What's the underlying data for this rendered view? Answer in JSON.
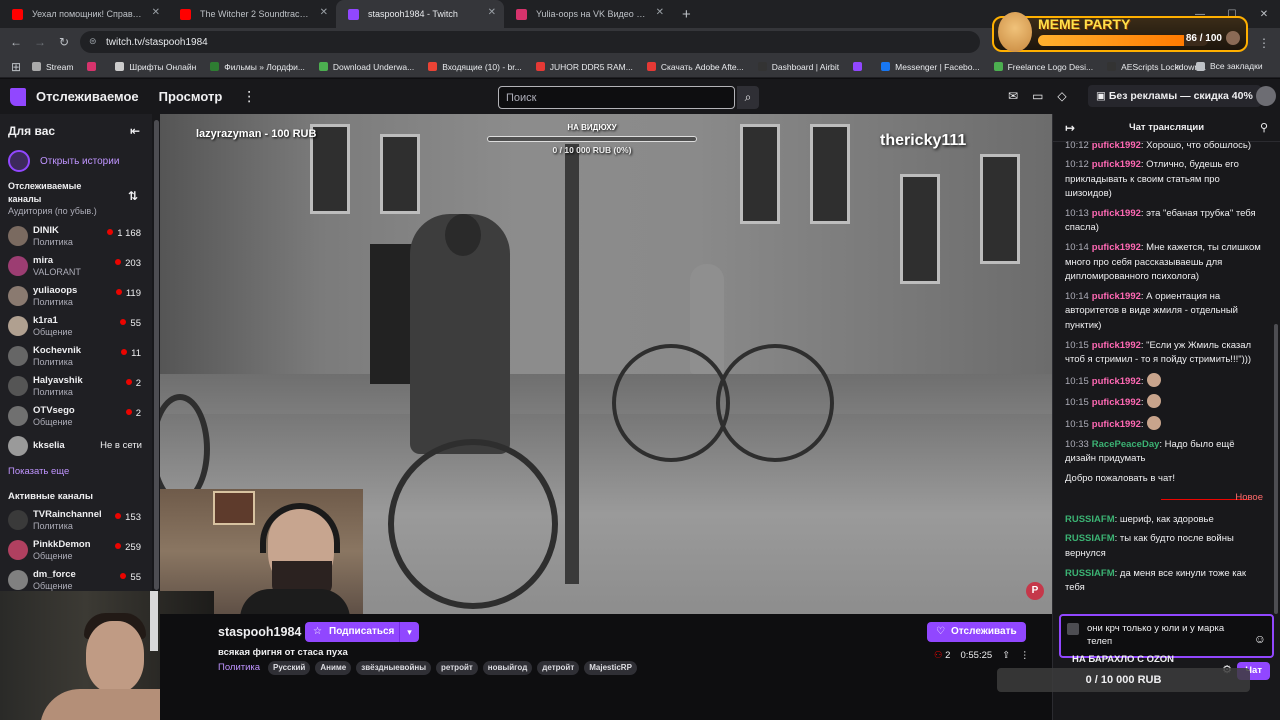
{
  "browser": {
    "tabs": [
      {
        "title": "Уехал помощник! Справляемся",
        "color": "#ff0000",
        "active": false
      },
      {
        "title": "The Witcher 2 Soundtrack - Sor",
        "color": "#ff0000",
        "active": false
      },
      {
        "title": "staspooh1984 - Twitch",
        "color": "#9147ff",
        "active": true
      },
      {
        "title": "Yulia-oops на VK Видео Live -",
        "color": "#d6336c",
        "active": false
      }
    ],
    "new_tab": "+",
    "url": "twitch.tv/staspooh1984",
    "bookmarks": [
      {
        "label": "Stream",
        "color": "#aaaaaa"
      },
      {
        "label": "",
        "color": "#d6336c"
      },
      {
        "label": "Шрифты Онлайн",
        "color": "#cccccc"
      },
      {
        "label": "Фильмы » Лордфи...",
        "color": "#2e7d32"
      },
      {
        "label": "Download Underwa...",
        "color": "#4caf50"
      },
      {
        "label": "Входящие (10) - br...",
        "color": "#ea4335"
      },
      {
        "label": "JUHOR DDR5 RAM...",
        "color": "#e53935"
      },
      {
        "label": "Скачать Adobe Afte...",
        "color": "#e53935"
      },
      {
        "label": "Dashboard | Airbit",
        "color": "#333333"
      },
      {
        "label": "",
        "color": "#9147ff"
      },
      {
        "label": "Messenger | Facebo...",
        "color": "#1877f2"
      },
      {
        "label": "Freelance Logo Desi...",
        "color": "#4caf50"
      },
      {
        "label": "AEScripts Lockdown...",
        "color": "#333333"
      }
    ],
    "bookmarks_more": "»",
    "all_bookmarks": "Все закладки"
  },
  "meme_party": {
    "title": "MEME PARTY",
    "count": "86 / 100",
    "progress": 0.86
  },
  "topnav": {
    "following": "Отслеживаемое",
    "browse": "Просмотр",
    "search_placeholder": "Поиск",
    "promo": "Без рекламы — скидка 40%"
  },
  "sidebar": {
    "title": "Для вас",
    "stories": "Открыть истории",
    "followed_title": "Отслеживаемые каналы",
    "followed_sub": "Аудитория (по убыв.)",
    "channels": [
      {
        "name": "DINIK",
        "game": "Политика",
        "viewers": "1 168",
        "color": "#7a6a60"
      },
      {
        "name": "mira",
        "game": "VALORANT",
        "viewers": "203",
        "color": "#9c3d72"
      },
      {
        "name": "yuliaoops",
        "game": "Политика",
        "viewers": "119",
        "color": "#8a7a70"
      },
      {
        "name": "k1ra1",
        "game": "Общение",
        "viewers": "55",
        "color": "#b0a090"
      },
      {
        "name": "Kochevnik",
        "game": "Политика",
        "viewers": "11",
        "color": "#666666"
      },
      {
        "name": "Halyavshik",
        "game": "Политика",
        "viewers": "2",
        "color": "#555555"
      },
      {
        "name": "OTVsego",
        "game": "Общение",
        "viewers": "2",
        "color": "#707070"
      }
    ],
    "offline_channel": {
      "name": "kkselia",
      "status": "Не в сети"
    },
    "show_more": "Показать еще",
    "active_title": "Активные каналы",
    "active_channels": [
      {
        "name": "TVRainchannel",
        "game": "Политика",
        "viewers": "153",
        "color": "#3a3a3a"
      },
      {
        "name": "PinkkDemon",
        "game": "Общение",
        "viewers": "259",
        "color": "#b04060"
      },
      {
        "name": "dm_force",
        "game": "Общение",
        "viewers": "55",
        "color": "#808080"
      }
    ]
  },
  "video": {
    "donor": "lazyrazyman - 100 RUB",
    "goal_title": "НА ВИДЮХУ",
    "goal_value": "0 / 10 000 RUB (0%)",
    "goal_progress": 0,
    "username": "thericky111",
    "badge": "P"
  },
  "stream": {
    "channel": "staspooh1984",
    "subscribe": "Подписаться",
    "follow": "Отслеживать",
    "title": "всякая фигня от стаса пуха",
    "category": "Политика",
    "tags": [
      "Русский",
      "Аниме",
      "звёздныевойны",
      "ретройт",
      "новыйгод",
      "детройт",
      "MajesticRP"
    ],
    "viewers": "2",
    "uptime": "0:55:25"
  },
  "chat": {
    "title": "Чат трансляции",
    "messages": [
      {
        "time": "10:12",
        "user": "pufick1992",
        "color": "#ff69b4",
        "text": ": Хорошо, что обошлось)"
      },
      {
        "time": "10:12",
        "user": "pufick1992",
        "color": "#ff69b4",
        "text": ": Отлично, будешь его прикладывать к своим статьям про шизоидов)"
      },
      {
        "time": "10:13",
        "user": "pufick1992",
        "color": "#ff69b4",
        "text": ": эта \"ебаная трубка\" тебя спасла)"
      },
      {
        "time": "10:14",
        "user": "pufick1992",
        "color": "#ff69b4",
        "text": ": Мне кажется, ты слишком много про себя рассказываешь для дипломированного психолога)"
      },
      {
        "time": "10:14",
        "user": "pufick1992",
        "color": "#ff69b4",
        "text": ": А ориентация на авторитетов в виде жмиля - отдельный пунктик)"
      },
      {
        "time": "10:15",
        "user": "pufick1992",
        "color": "#ff69b4",
        "text": ": \"Если уж Жмиль сказал чтоб я стримил - то я пойду стримить!!!\")))"
      },
      {
        "time": "10:15",
        "user": "pufick1992",
        "color": "#ff69b4",
        "text": ":",
        "emote": true
      },
      {
        "time": "10:15",
        "user": "pufick1992",
        "color": "#ff69b4",
        "text": ":",
        "emote": true
      },
      {
        "time": "10:15",
        "user": "pufick1992",
        "color": "#ff69b4",
        "text": ":",
        "emote": true
      },
      {
        "time": "10:33",
        "user": "RacePeaceDay",
        "color": "#3bb273",
        "text": ": Надо было ещё дизайн придумать"
      }
    ],
    "welcome": "Добро пожаловать в чат!",
    "new_label": "Новое",
    "new_messages": [
      {
        "user": "RUSSIAFM",
        "color": "#3bb273",
        "text": ": шериф, как здоровье"
      },
      {
        "user": "RUSSIAFM",
        "color": "#3bb273",
        "text": ": ты как будто после войны вернулся"
      },
      {
        "user": "RUSSIAFM",
        "color": "#3bb273",
        "text": ": да меня все кинули тоже как тебя"
      }
    ],
    "input_text": "они крч только у юли и у марка телеп",
    "overlay_label": "НА БАРАХЛО С OZON",
    "chat_button": "Чат",
    "bottom_goal": "0 / 10 000 RUB"
  }
}
